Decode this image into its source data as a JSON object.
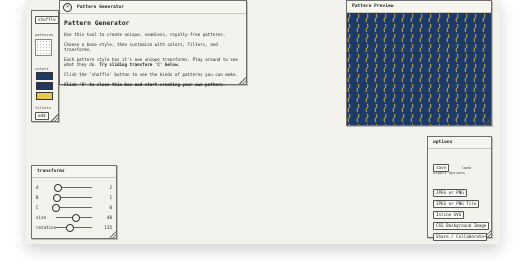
{
  "tools": {
    "shuffle_label": "shuffle",
    "patterns_label": "patterns",
    "colors_label": "colors",
    "colors": [
      "#1e3a68",
      "#24365e",
      "#e6c84a"
    ],
    "filters_label": "filters",
    "add_label": "add"
  },
  "intro": {
    "window_title": "Pattern Generator",
    "heading": "Pattern Generator",
    "p1": "Use this tool to create unique, seamless, royalty-free patterns.",
    "p2": "Choose a base style, then customize with colors, filters, and transforms.",
    "p3a": "Each pattern style has it's own unique transforms. Play around to see what they do.",
    "p3b": "Try sliding transform 'C' below.",
    "p4": "Click the 'shuffle' button to see the kinds of patterns you can make.",
    "p5": "Click 'X' to close this box and start creating your own pattern.",
    "close_glyph": "×"
  },
  "preview": {
    "title": "Pattern Preview",
    "background": "#1e3a68",
    "mark_color": "#e6c84a"
  },
  "transforms": {
    "title": "transforms",
    "rows": [
      {
        "label": "A",
        "value": "2",
        "level": 0.05
      },
      {
        "label": "B",
        "value": "1",
        "level": 0.02
      },
      {
        "label": "C",
        "value": "0",
        "level": 0.0
      },
      {
        "label": "size",
        "value": "40",
        "level": 0.55
      },
      {
        "label": "rotation",
        "value": "135",
        "level": 0.4
      }
    ]
  },
  "options": {
    "title": "options",
    "save_label": "save",
    "load_label": "load",
    "export_label": "Export Options",
    "exports": [
      "JPEG or PNG",
      "JPEG or PNG Tile",
      "Inline SVG",
      "CSS Background Image",
      "Share / Collaborate"
    ]
  }
}
